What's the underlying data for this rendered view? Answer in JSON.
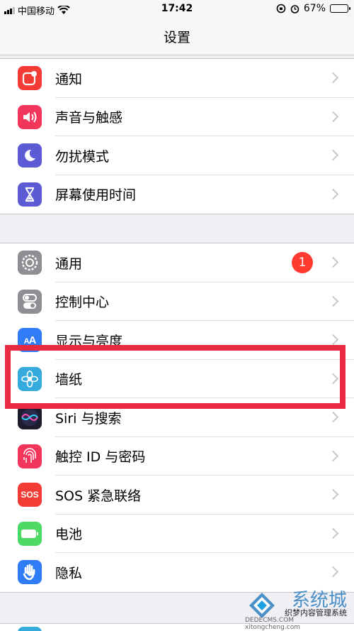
{
  "status_bar": {
    "carrier": "中国移动",
    "time": "17:42",
    "battery_percent": "67%",
    "battery_level": 0.67,
    "icons": [
      "signal-icon",
      "wifi-icon",
      "orientation-lock-icon",
      "alarm-icon",
      "battery-icon"
    ]
  },
  "nav": {
    "title": "设置"
  },
  "group1": {
    "items": [
      {
        "label": "通知",
        "icon": "notifications-icon",
        "color": "#f33c35"
      },
      {
        "label": "声音与触感",
        "icon": "sound-icon",
        "color": "#f2355a"
      },
      {
        "label": "勿扰模式",
        "icon": "moon-icon",
        "color": "#5d5ad6"
      },
      {
        "label": "屏幕使用时间",
        "icon": "hourglass-icon",
        "color": "#5d5ad6"
      }
    ]
  },
  "group2": {
    "items": [
      {
        "label": "通用",
        "icon": "gear-icon",
        "color": "#8e8e93",
        "badge": "1"
      },
      {
        "label": "控制中心",
        "icon": "toggles-icon",
        "color": "#8e8e93"
      },
      {
        "label": "显示与亮度",
        "icon": "text-size-icon",
        "color": "#2f7cf6"
      },
      {
        "label": "墙纸",
        "icon": "flower-icon",
        "color": "#35aadc"
      },
      {
        "label": "Siri 与搜索",
        "icon": "siri-icon",
        "color": "#1c1c2e"
      },
      {
        "label": "触控 ID 与密码",
        "icon": "fingerprint-icon",
        "color": "#f2355a"
      },
      {
        "label": "SOS 紧急联络",
        "icon": "sos-icon",
        "color": "#f33c35",
        "icon_text": "SOS"
      },
      {
        "label": "电池",
        "icon": "battery-app-icon",
        "color": "#4cd964"
      },
      {
        "label": "隐私",
        "icon": "hand-icon",
        "color": "#2f7cf6"
      }
    ]
  },
  "annotation": {
    "highlight_color": "#e8293f"
  },
  "watermark": {
    "logo_text": "系统城",
    "line1": "织梦内容管理系统",
    "line2": "DEDECMS.COM",
    "line3": "xitongcheng.com"
  }
}
